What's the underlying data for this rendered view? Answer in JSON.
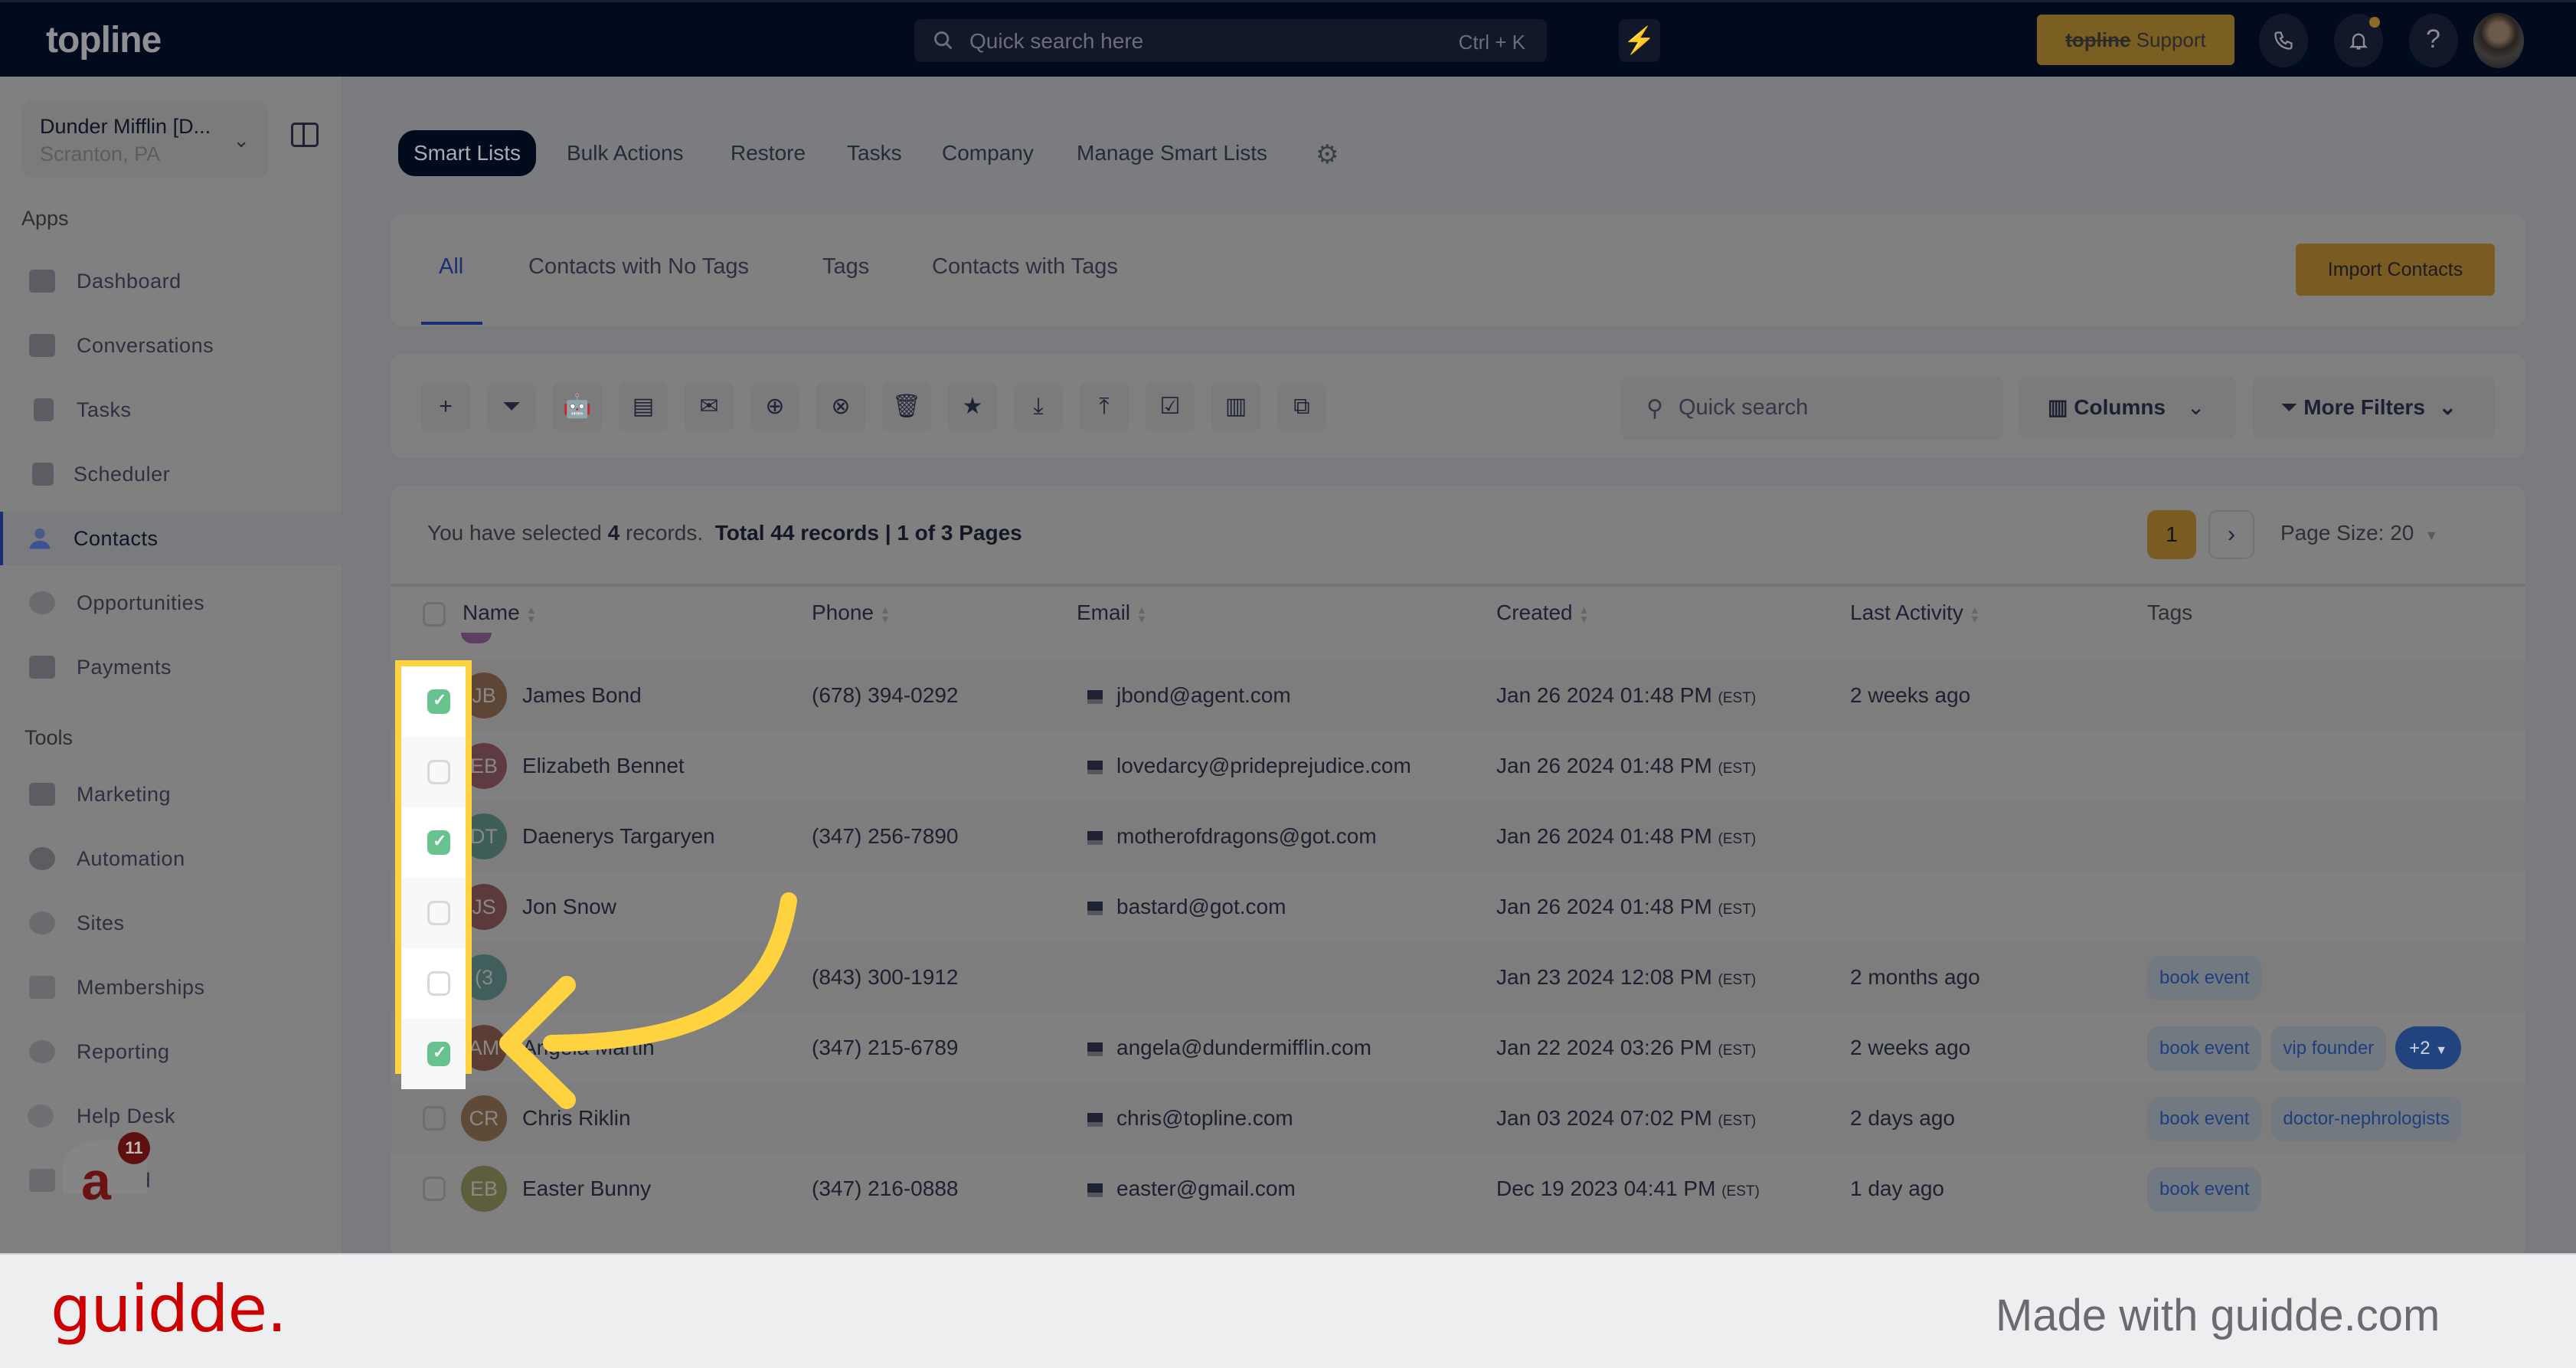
{
  "topbar": {
    "logo": "topline",
    "search_placeholder": "Quick search here",
    "search_shortcut": "Ctrl + K",
    "support_brand": "topline",
    "support_label": "Support",
    "icons": [
      "lightning-icon",
      "phone-icon",
      "bell-icon",
      "help-icon",
      "user-avatar"
    ]
  },
  "sidebar": {
    "location_name": "Dunder Mifflin [D...",
    "location_sub": "Scranton, PA",
    "apps_heading": "Apps",
    "apps": [
      {
        "label": "Dashboard",
        "icon": "dashboard-icon"
      },
      {
        "label": "Conversations",
        "icon": "chat-icon"
      },
      {
        "label": "Tasks",
        "icon": "task-icon"
      },
      {
        "label": "Scheduler",
        "icon": "calendar-icon"
      },
      {
        "label": "Contacts",
        "icon": "user-icon",
        "active": true
      },
      {
        "label": "Opportunities",
        "icon": "target-icon"
      },
      {
        "label": "Payments",
        "icon": "credit-card-icon"
      }
    ],
    "tools_heading": "Tools",
    "tools": [
      {
        "label": "Marketing",
        "icon": "megaphone-icon"
      },
      {
        "label": "Automation",
        "icon": "gears-icon"
      },
      {
        "label": "Sites",
        "icon": "globe-icon"
      },
      {
        "label": "Memberships",
        "icon": "members-icon"
      },
      {
        "label": "Reporting",
        "icon": "pie-chart-icon"
      },
      {
        "label": "Help Desk",
        "icon": "help-circle-icon"
      },
      {
        "label": "Mailfold",
        "icon": "mail-icon"
      }
    ],
    "widget_badge": "11"
  },
  "subnav": {
    "items": [
      "Smart Lists",
      "Bulk Actions",
      "Restore",
      "Tasks",
      "Company",
      "Manage Smart Lists"
    ],
    "active": "Smart Lists"
  },
  "list_tabs": {
    "items": [
      "All",
      "Contacts with No Tags",
      "Tags",
      "Contacts with Tags"
    ],
    "active": "All",
    "import_button": "Import Contacts"
  },
  "toolbar": {
    "actions": [
      {
        "name": "add-contact",
        "glyph": "+"
      },
      {
        "name": "filter",
        "glyph": "⏷"
      },
      {
        "name": "automation-bot",
        "glyph": "🤖"
      },
      {
        "name": "send-sms",
        "glyph": "▤"
      },
      {
        "name": "send-email",
        "glyph": "✉"
      },
      {
        "name": "add-tag",
        "glyph": "⊕"
      },
      {
        "name": "remove-tag",
        "glyph": "⊗"
      },
      {
        "name": "delete",
        "glyph": "🗑"
      },
      {
        "name": "star",
        "glyph": "★"
      },
      {
        "name": "import",
        "glyph": "⤓"
      },
      {
        "name": "export",
        "glyph": "⤒"
      },
      {
        "name": "review-request",
        "glyph": "☑"
      },
      {
        "name": "company",
        "glyph": "▥"
      },
      {
        "name": "merge",
        "glyph": "⧉"
      }
    ],
    "search_placeholder": "Quick search",
    "columns_label": "Columns",
    "more_filters_label": "More Filters"
  },
  "summary": {
    "selected_prefix": "You have selected",
    "selected_count": "4",
    "selected_suffix": "records.",
    "total": "Total 44 records",
    "pages": "1 of 3 Pages",
    "current_page": "1",
    "page_size": "Page Size: 20"
  },
  "table": {
    "headers": [
      "Name",
      "Phone",
      "Email",
      "Created",
      "Last Activity",
      "Tags"
    ],
    "rows": [
      {
        "initials": "JB",
        "avatar_color": "#5e4636",
        "name": "James Bond",
        "phone": "(678) 394-0292",
        "email": "jbond@agent.com",
        "created": "Jan 26 2024 01:48 PM",
        "tz": "(EST)",
        "last_activity": "2 weeks ago",
        "tags": [],
        "checked": true
      },
      {
        "initials": "EB",
        "avatar_color": "#5e3b40",
        "name": "Elizabeth Bennet",
        "phone": "",
        "email": "lovedarcy@prideprejudice.com",
        "created": "Jan 26 2024 01:48 PM",
        "tz": "(EST)",
        "last_activity": "",
        "tags": [],
        "checked": false
      },
      {
        "initials": "DT",
        "avatar_color": "#3f5e58",
        "name": "Daenerys Targaryen",
        "phone": "(347) 256-7890",
        "email": "motherofdragons@got.com",
        "created": "Jan 26 2024 01:48 PM",
        "tz": "(EST)",
        "last_activity": "",
        "tags": [],
        "checked": true
      },
      {
        "initials": "JS",
        "avatar_color": "#5c3a3a",
        "name": "Jon Snow",
        "phone": "",
        "email": "bastard@got.com",
        "created": "Jan 26 2024 01:48 PM",
        "tz": "(EST)",
        "last_activity": "",
        "tags": [],
        "checked": false
      },
      {
        "initials": "(3",
        "avatar_color": "#3f5e5c",
        "name": "",
        "phone": "(843) 300-1912",
        "email": "",
        "created": "Jan 23 2024 12:08 PM",
        "tz": "(EST)",
        "last_activity": "2 months ago",
        "tags": [
          "book event"
        ],
        "checked": false
      },
      {
        "initials": "AM",
        "avatar_color": "#5a3e36",
        "name": "Angela Martin",
        "phone": "(347) 215-6789",
        "email": "angela@dundermifflin.com",
        "created": "Jan 22 2024 03:26 PM",
        "tz": "(EST)",
        "last_activity": "2 weeks ago",
        "tags": [
          "book event",
          "vip founder"
        ],
        "more_tags": "+2",
        "checked": true
      },
      {
        "initials": "CR",
        "avatar_color": "#5e4a36",
        "name": "Chris Riklin",
        "phone": "",
        "email": "chris@topline.com",
        "created": "Jan 03 2024 07:02 PM",
        "tz": "(EST)",
        "last_activity": "2 days ago",
        "tags": [
          "book event",
          "doctor-nephrologists"
        ],
        "checked": false
      },
      {
        "initials": "EB",
        "avatar_color": "#5e5e3c",
        "name": "Easter Bunny",
        "phone": "(347) 216-0888",
        "email": "easter@gmail.com",
        "created": "Dec 19 2023 04:41 PM",
        "tz": "(EST)",
        "last_activity": "1 day ago",
        "tags": [
          "book event"
        ],
        "checked": false
      }
    ]
  },
  "annotation": {
    "highlight_color": "#ffd23f",
    "description": "Checkbox column highlighted with arrow pointing to selected rows"
  },
  "footer": {
    "brand": "guidde.",
    "made_with": "Made with guidde.com"
  }
}
